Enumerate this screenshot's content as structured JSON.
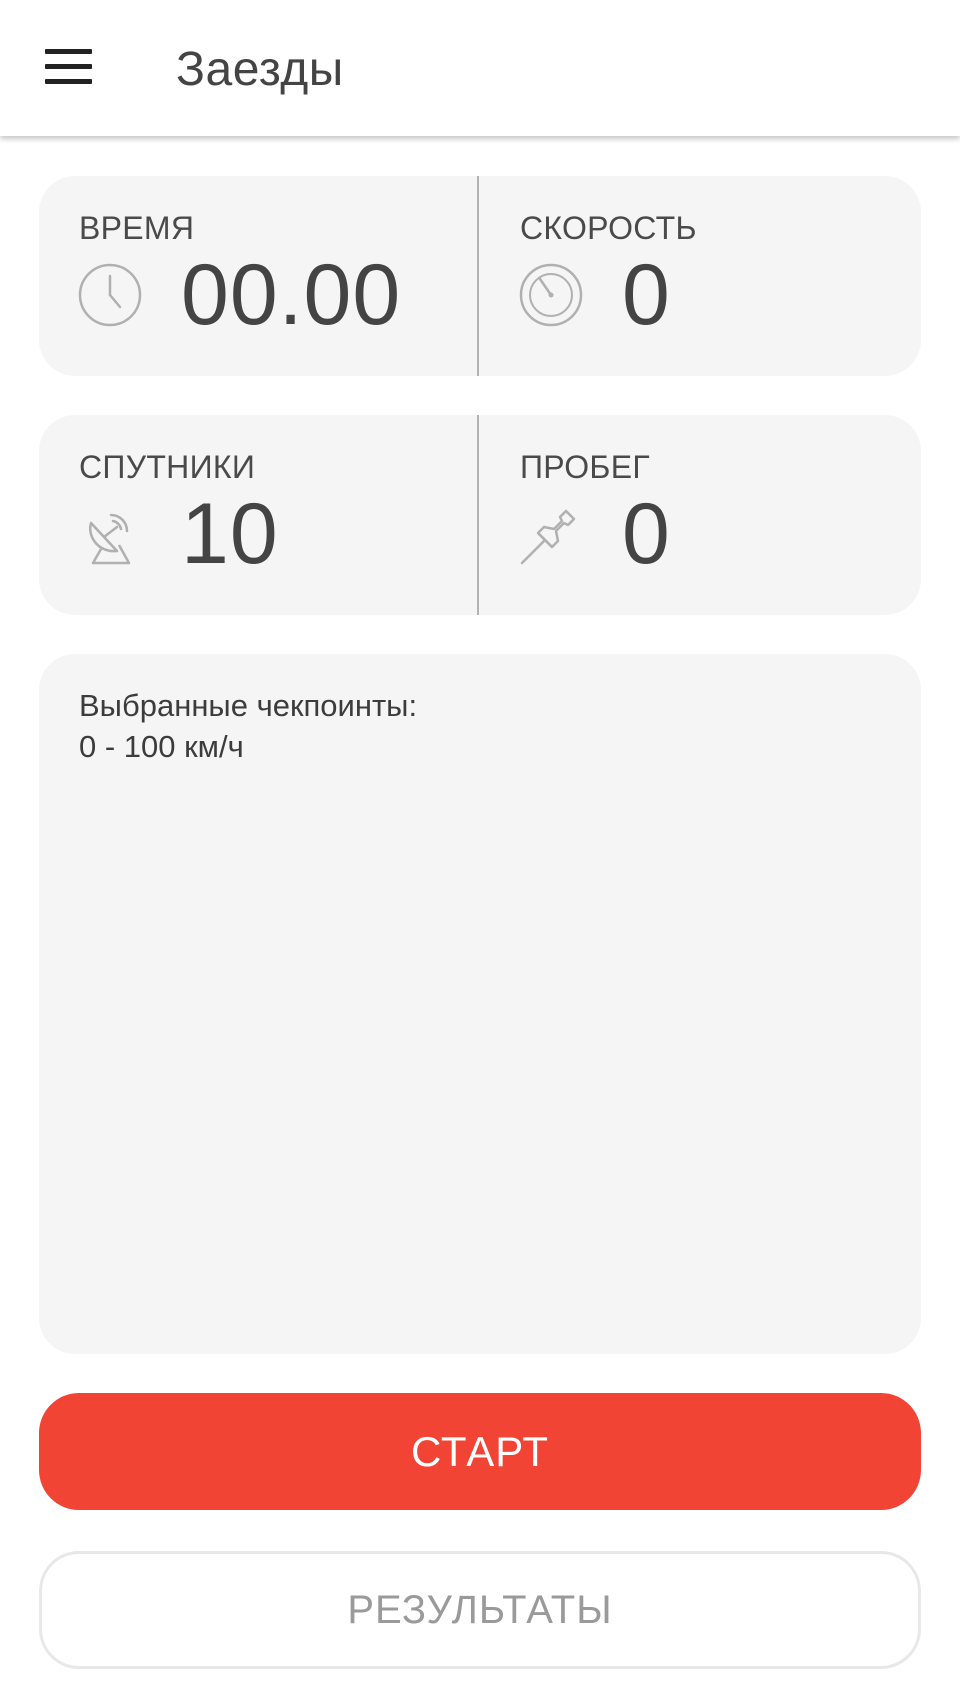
{
  "header": {
    "title": "Заезды",
    "menu_icon": "hamburger-menu-icon"
  },
  "stats": {
    "time": {
      "label": "ВРЕМЯ",
      "value": "00.00",
      "icon": "clock-icon"
    },
    "speed": {
      "label": "СКОРОСТЬ",
      "value": "0",
      "icon": "speedometer-icon"
    },
    "satellites": {
      "label": "СПУТНИКИ",
      "value": "10",
      "icon": "satellite-dish-icon"
    },
    "distance": {
      "label": "ПРОБЕГ",
      "value": "0",
      "icon": "pushpin-icon"
    }
  },
  "checkpoints": {
    "title": "Выбранные чекпоинты:",
    "items": [
      "0 - 100 км/ч"
    ]
  },
  "buttons": {
    "start": "СТАРТ",
    "results": "РЕЗУЛЬТАТЫ"
  },
  "colors": {
    "accent": "#f24435",
    "card_bg": "#f5f5f5",
    "text": "#4a4a4a"
  }
}
